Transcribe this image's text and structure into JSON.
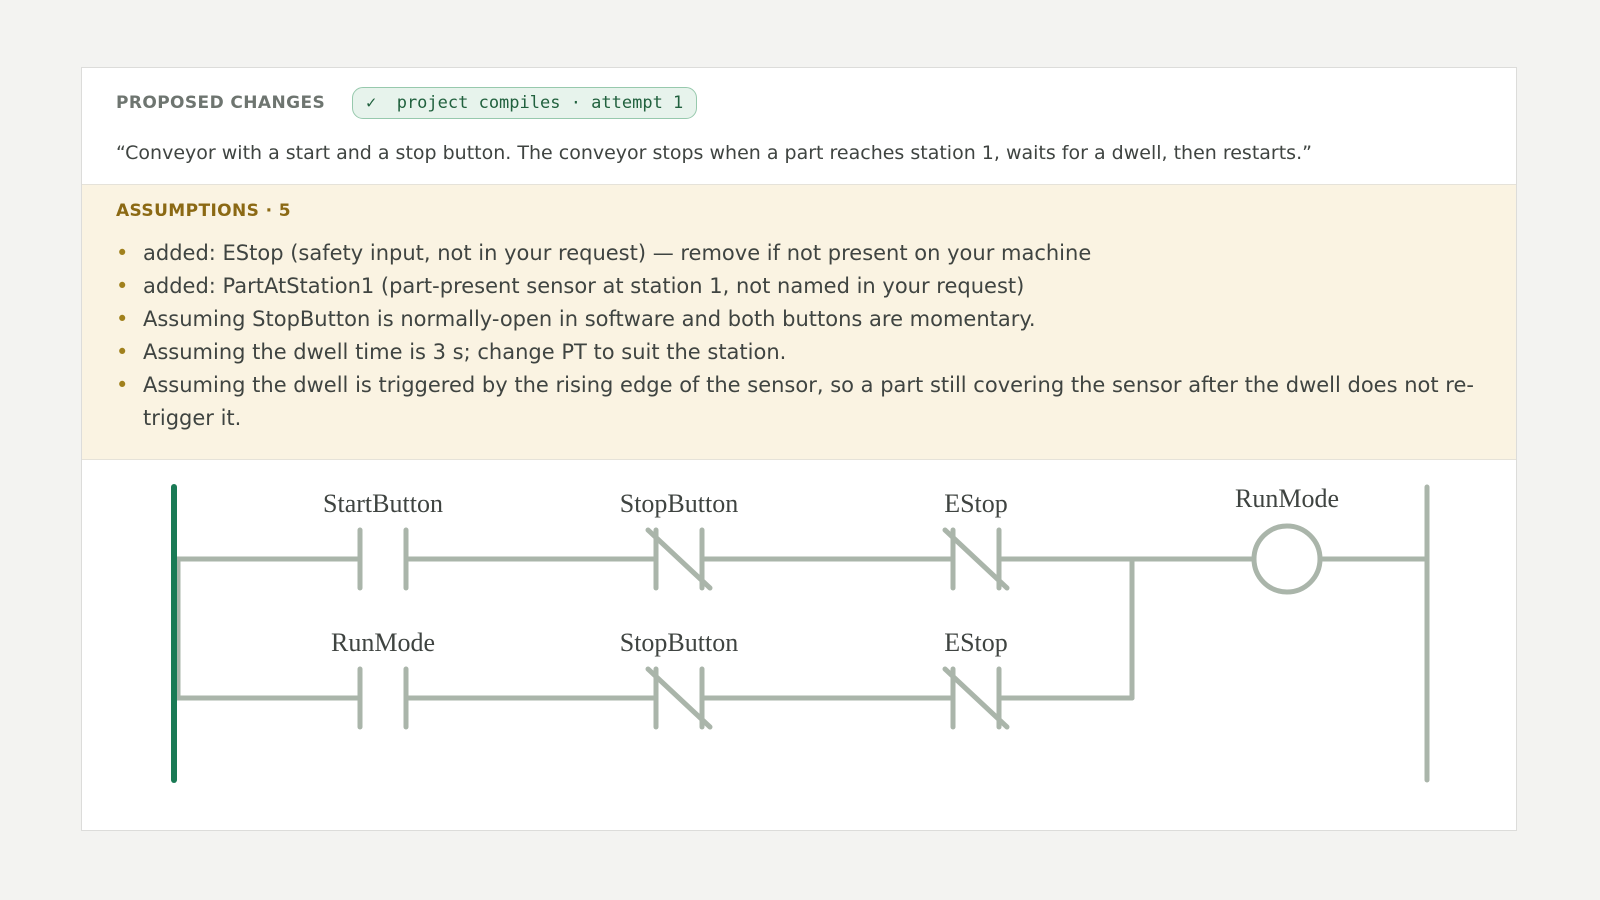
{
  "header": {
    "section_label": "PROPOSED CHANGES",
    "badge": "✓  project compiles · attempt 1",
    "prompt": "“Conveyor with a start and a stop button. The conveyor stops when a part reaches station 1, waits for a dwell, then restarts.”"
  },
  "assumptions": {
    "title": "ASSUMPTIONS · 5",
    "items": [
      "added: EStop (safety input, not in your request) — remove if not present on your machine",
      "added: PartAtStation1 (part-present sensor at station 1, not named in your request)",
      "Assuming StopButton is normally-open in software and both buttons are momentary.",
      "Assuming the dwell time is 3 s; change PT to suit the station.",
      "Assuming the dwell is triggered by the rising edge of the sensor, so a part still covering the sensor after the dwell does not re-trigger it."
    ]
  },
  "ladder": {
    "colors": {
      "wire": "#aab5aa",
      "power_rail": "#1a7a55",
      "label": "#3f4441"
    },
    "rungs": [
      {
        "contacts": [
          {
            "type": "NO",
            "label": "StartButton"
          },
          {
            "type": "NC",
            "label": "StopButton"
          },
          {
            "type": "NC",
            "label": "EStop"
          }
        ],
        "coil": {
          "label": "RunMode"
        }
      },
      {
        "contacts": [
          {
            "type": "NO",
            "label": "RunMode"
          },
          {
            "type": "NC",
            "label": "StopButton"
          },
          {
            "type": "NC",
            "label": "EStop"
          }
        ]
      }
    ]
  }
}
